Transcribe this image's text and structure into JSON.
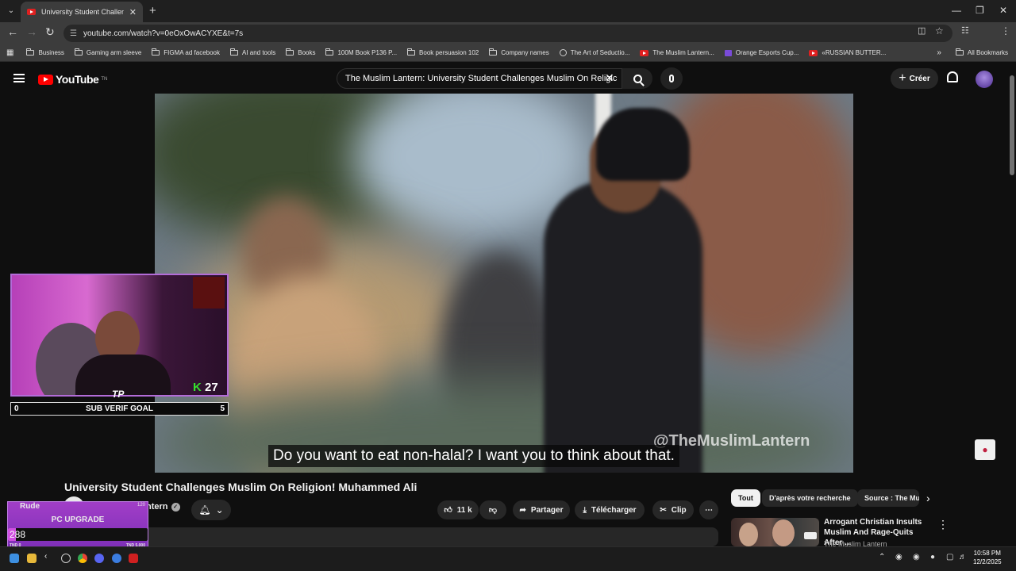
{
  "browser": {
    "tab_title": "University Student Challenges Mus",
    "url": "youtube.com/watch?v=0eOxOwACYXE&t=7s",
    "bookmarks": [
      {
        "label": "Business",
        "icon": "folder-icon"
      },
      {
        "label": "Gaming arm sleeve",
        "icon": "folder-icon"
      },
      {
        "label": "FIGMA ad facebook",
        "icon": "folder-icon"
      },
      {
        "label": "AI and tools",
        "icon": "folder-icon"
      },
      {
        "label": "Books",
        "icon": "folder-icon"
      },
      {
        "label": "100M Book P136 P...",
        "icon": "folder-icon"
      },
      {
        "label": "Book persuasion 102",
        "icon": "folder-icon"
      },
      {
        "label": "Company names",
        "icon": "folder-icon"
      },
      {
        "label": "The Art of Seductio...",
        "icon": "globe-icon"
      },
      {
        "label": "The Muslim Lantern...",
        "icon": "youtube-icon"
      },
      {
        "label": "Orange Esports Cup...",
        "icon": "list-icon"
      },
      {
        "label": "«RUSSIAN BUTTER...",
        "icon": "youtube-icon"
      }
    ],
    "all_bookmarks": "All Bookmarks",
    "more_bookmarks": "»"
  },
  "youtube": {
    "logo_text": "YouTube",
    "logo_sup": "TN",
    "search_query": "The Muslim Lantern: University Student Challenges Muslim On Religic",
    "create_label": "Créer"
  },
  "video": {
    "subtitle": "Do you want to eat non-halal? I want you to think about that.",
    "watermark": "@TheMuslimLantern",
    "title": "University Student Challenges Muslim On Religion! Muhammed Ali",
    "channel_partial": "ntern",
    "likes": "11 k",
    "share_label": "Partager",
    "download_label": "Télécharger",
    "clip_label": "Clip"
  },
  "stream_overlay": {
    "k_letter": "K",
    "k_count": "27",
    "logo": "TP",
    "goal_start": "0",
    "goal_label": "SUB VERIF GOAL",
    "goal_end": "5",
    "donor": "Rude",
    "donor_amount": "120",
    "upgrade_label": "PC UPGRADE",
    "upgrade_value": "288",
    "upgrade_fraction": 0.058,
    "upgrade_min": "TND 0",
    "upgrade_max": "TND 5,000"
  },
  "chips": [
    "Tout",
    "D'après votre recherche",
    "Source : The Mu"
  ],
  "related": {
    "title": "Arrogant Christian Insults Muslim And Rage-Quits After ...",
    "channel": "The Muslim Lantern"
  },
  "taskbar": {
    "time": "10:58 PM",
    "date": "12/2/2025"
  },
  "colors": {
    "youtube_red": "#ff0000",
    "overlay_purple": "#a13ec7",
    "k_green": "#34e02c"
  }
}
